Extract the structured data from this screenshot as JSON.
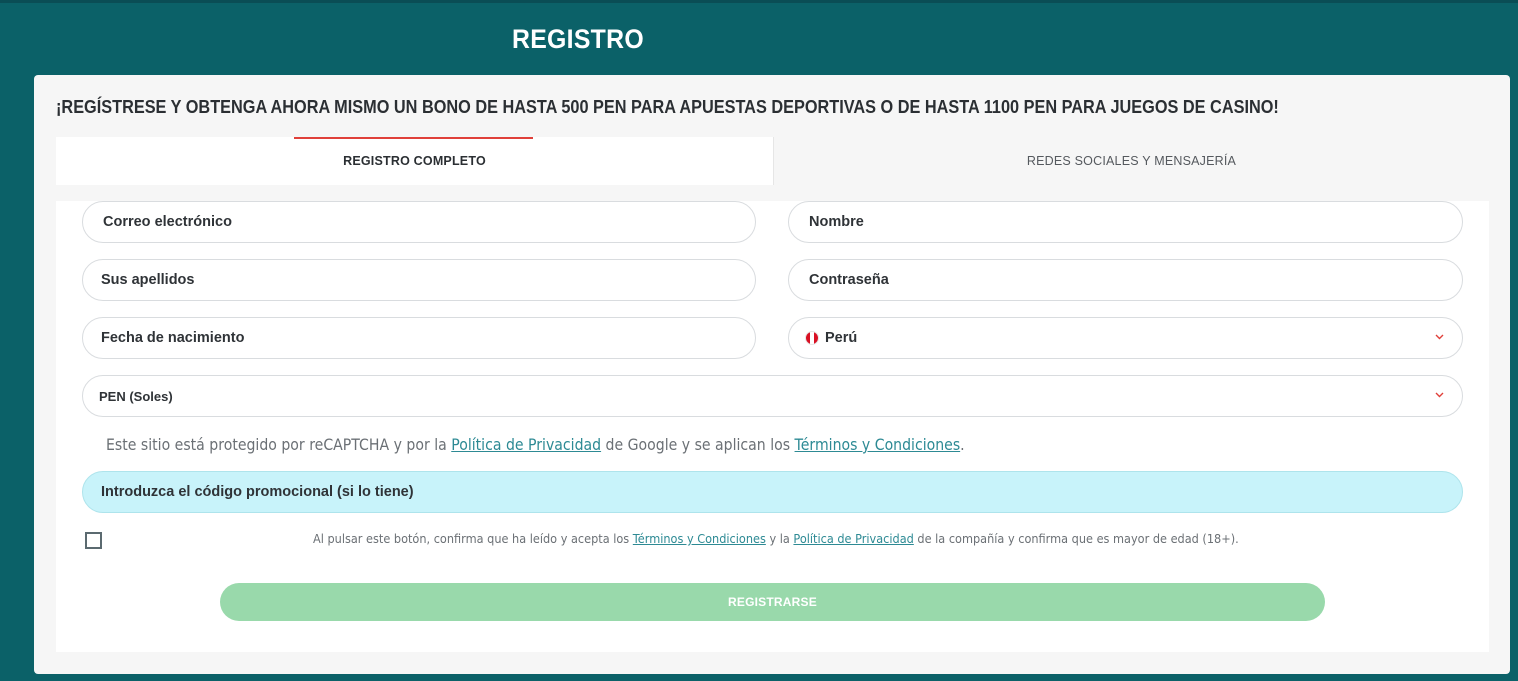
{
  "header": {
    "title": "REGISTRO"
  },
  "promo_headline": "¡REGÍSTRESE Y OBTENGA AHORA MISMO UN BONO DE HASTA 500 PEN PARA APUESTAS DEPORTIVAS O DE HASTA 1100 PEN PARA JUEGOS DE CASINO!",
  "tabs": [
    {
      "label": "REGISTRO COMPLETO",
      "active": true
    },
    {
      "label": "REDES SOCIALES Y MENSAJERÍA",
      "active": false
    }
  ],
  "form": {
    "email_placeholder": "Correo electrónico",
    "first_name_placeholder": "Nombre",
    "last_name_placeholder": "Sus apellidos",
    "password_placeholder": "Contraseña",
    "birthdate_placeholder": "Fecha de nacimiento",
    "country_value": "Perú",
    "currency_value": "PEN (Soles)",
    "promo_code_placeholder": "Introduzca el código promocional (si lo tiene)"
  },
  "recaptcha": {
    "text_1": "Este sitio está protegido por reCAPTCHA y por la ",
    "privacy_link": "Política de Privacidad",
    "text_2": " de Google y se aplican los ",
    "terms_link": "Términos y Condiciones",
    "text_3": "."
  },
  "consent": {
    "text_1": "Al pulsar este botón, confirma que ha leído y acepta los ",
    "terms_link": "Términos y Condiciones",
    "text_2": " y la ",
    "privacy_link": "Política de Privacidad",
    "text_3": " de la compañía y confirma que es mayor de edad (18+).",
    "checked": false
  },
  "submit": {
    "label": "REGISTRARSE"
  },
  "icons": {
    "country_flag": "peru-flag-icon",
    "dropdown": "chevron-down-icon"
  },
  "colors": {
    "background": "#0b6168",
    "accent_tab": "#e0403a",
    "link": "#2d8a94",
    "promo_field": "#c8f3fa",
    "submit_button": "#99d9ab",
    "chevron": "#e0403a"
  }
}
